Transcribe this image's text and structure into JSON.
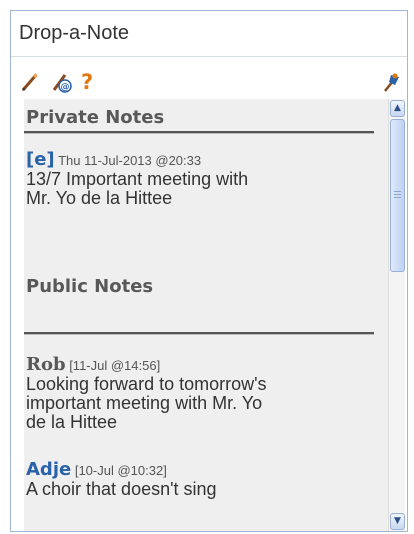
{
  "widget": {
    "title": "Drop-a-Note"
  },
  "toolbar": {
    "icons": [
      "pencil-icon",
      "user-at-icon",
      "help-icon",
      "pin-icon"
    ],
    "help_glyph": "?"
  },
  "private_section": {
    "heading": "Private Notes",
    "notes": [
      {
        "author": "[e]",
        "meta": "Thu 11-Jul-2013 @20:33",
        "body_lines": [
          "13/7 Important meeting with",
          "Mr. Yo de la Hittee"
        ]
      }
    ]
  },
  "public_section": {
    "heading": "Public Notes",
    "notes": [
      {
        "author": "Rob",
        "meta": "[11-Jul @14:56]",
        "body_lines": [
          "Looking forward to tomorrow's",
          "important meeting with Mr. Yo",
          "de la Hittee"
        ]
      },
      {
        "author": "Adje",
        "meta": "[10-Jul @10:32]",
        "body_lines": [
          "A choir that doesn't sing"
        ]
      }
    ]
  },
  "scrollbar": {
    "up_glyph": "▲",
    "down_glyph": "▼"
  },
  "colors": {
    "accent": "#2a62a8",
    "help": "#e0780f",
    "panel_bg": "#efefef"
  }
}
